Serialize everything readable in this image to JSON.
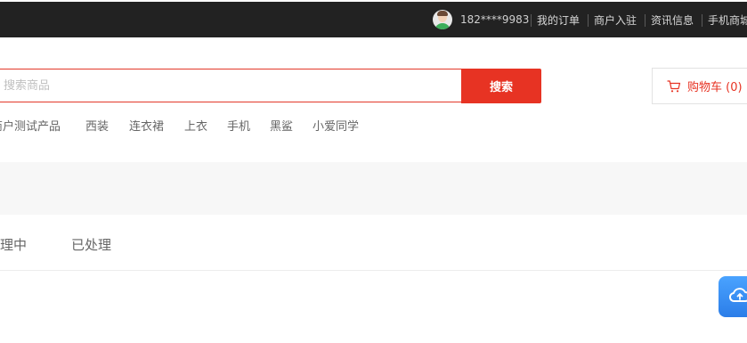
{
  "topbar": {
    "phone": "182****9983",
    "links": [
      "我的订单",
      "商户入驻",
      "资讯信息",
      "手机商城"
    ]
  },
  "search": {
    "placeholder": "搜索商品",
    "button_label": "搜索"
  },
  "cart": {
    "label": "购物车 (0)"
  },
  "hot_keywords": [
    "商户测试产品",
    "西装",
    "连衣裙",
    "上衣",
    "手机",
    "黑鲨",
    "小爱同学"
  ],
  "tabs": [
    "处理中",
    "已处理"
  ],
  "colors": {
    "accent": "#e73323",
    "topbar_bg": "#222222",
    "widget": "#3b8ff5"
  },
  "icons": {
    "cart": "cart-icon",
    "avatar": "avatar",
    "widget": "cloud-icon"
  }
}
